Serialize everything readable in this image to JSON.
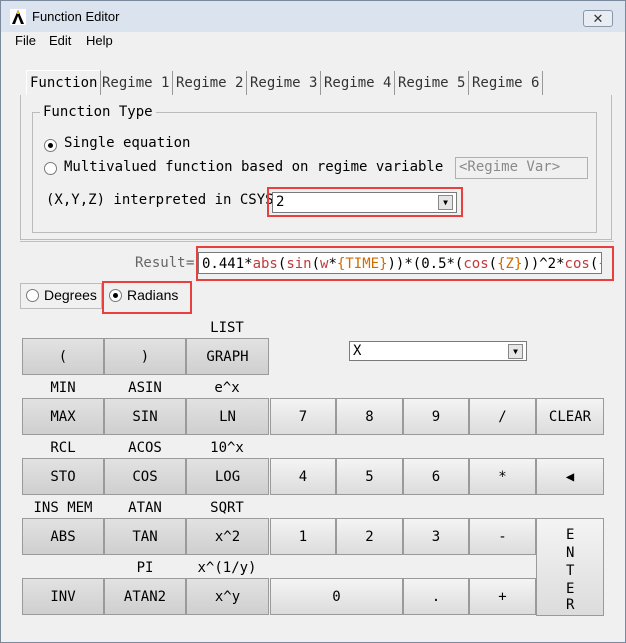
{
  "window": {
    "title": "Function Editor",
    "close_glyph": "✕"
  },
  "menu": [
    "File",
    "Edit",
    "Help"
  ],
  "tabs": [
    "Function",
    "Regime 1",
    "Regime 2",
    "Regime 3",
    "Regime 4",
    "Regime 5",
    "Regime 6"
  ],
  "function_type": {
    "label": "Function Type",
    "option_single": "Single equation",
    "option_multi": "Multivalued function based on regime variable",
    "regime_var_placeholder": "<Regime Var>",
    "csys_label": "(X,Y,Z) interpreted in CSYS:",
    "csys_value": "2"
  },
  "result": {
    "label": "Result",
    "eq": "=",
    "tokens": [
      {
        "t": "0.441*",
        "k": "pl"
      },
      {
        "t": "abs",
        "k": "fn"
      },
      {
        "t": "(",
        "k": "pl"
      },
      {
        "t": "sin",
        "k": "fn"
      },
      {
        "t": "(",
        "k": "pl"
      },
      {
        "t": "w",
        "k": "fn"
      },
      {
        "t": "*",
        "k": "pl"
      },
      {
        "t": "{TIME}",
        "k": "var"
      },
      {
        "t": "))*(0.5*(",
        "k": "pl"
      },
      {
        "t": "cos",
        "k": "fn"
      },
      {
        "t": "(",
        "k": "pl"
      },
      {
        "t": "{Z}",
        "k": "var"
      },
      {
        "t": "))^2*",
        "k": "pl"
      },
      {
        "t": "cos",
        "k": "fn"
      },
      {
        "t": "(",
        "k": "pl"
      },
      {
        "t": "{Y}",
        "k": "var"
      }
    ]
  },
  "angle": {
    "degrees": "Degrees",
    "radians": "Radians",
    "selected": "Radians"
  },
  "variable_select": "X",
  "keys": {
    "open_paren": "(",
    "close_paren": ")",
    "list": "LIST",
    "graph": "GRAPH",
    "min": "MIN",
    "max": "MAX",
    "asin": "ASIN",
    "sin": "SIN",
    "exp": "e^x",
    "ln": "LN",
    "rcl": "RCL",
    "sto": "STO",
    "acos": "ACOS",
    "cos": "COS",
    "pow10": "10^x",
    "log": "LOG",
    "ins_mem": "INS MEM",
    "abs": "ABS",
    "atan": "ATAN",
    "tan": "TAN",
    "sqrt": "SQRT",
    "sq": "x^2",
    "pi": "PI",
    "inv": "INV",
    "atan2": "ATAN2",
    "root": "x^(1/y)",
    "pow": "x^y",
    "d7": "7",
    "d8": "8",
    "d9": "9",
    "div": "/",
    "clear": "CLEAR",
    "d4": "4",
    "d5": "5",
    "d6": "6",
    "mul": "*",
    "backspace": "◀",
    "d1": "1",
    "d2": "2",
    "d3": "3",
    "sub": "-",
    "d0": "0",
    "dot": ".",
    "add": "+",
    "enter": [
      "E",
      "N",
      "T",
      "E",
      "R"
    ]
  },
  "highlight_color": "#e8403f"
}
